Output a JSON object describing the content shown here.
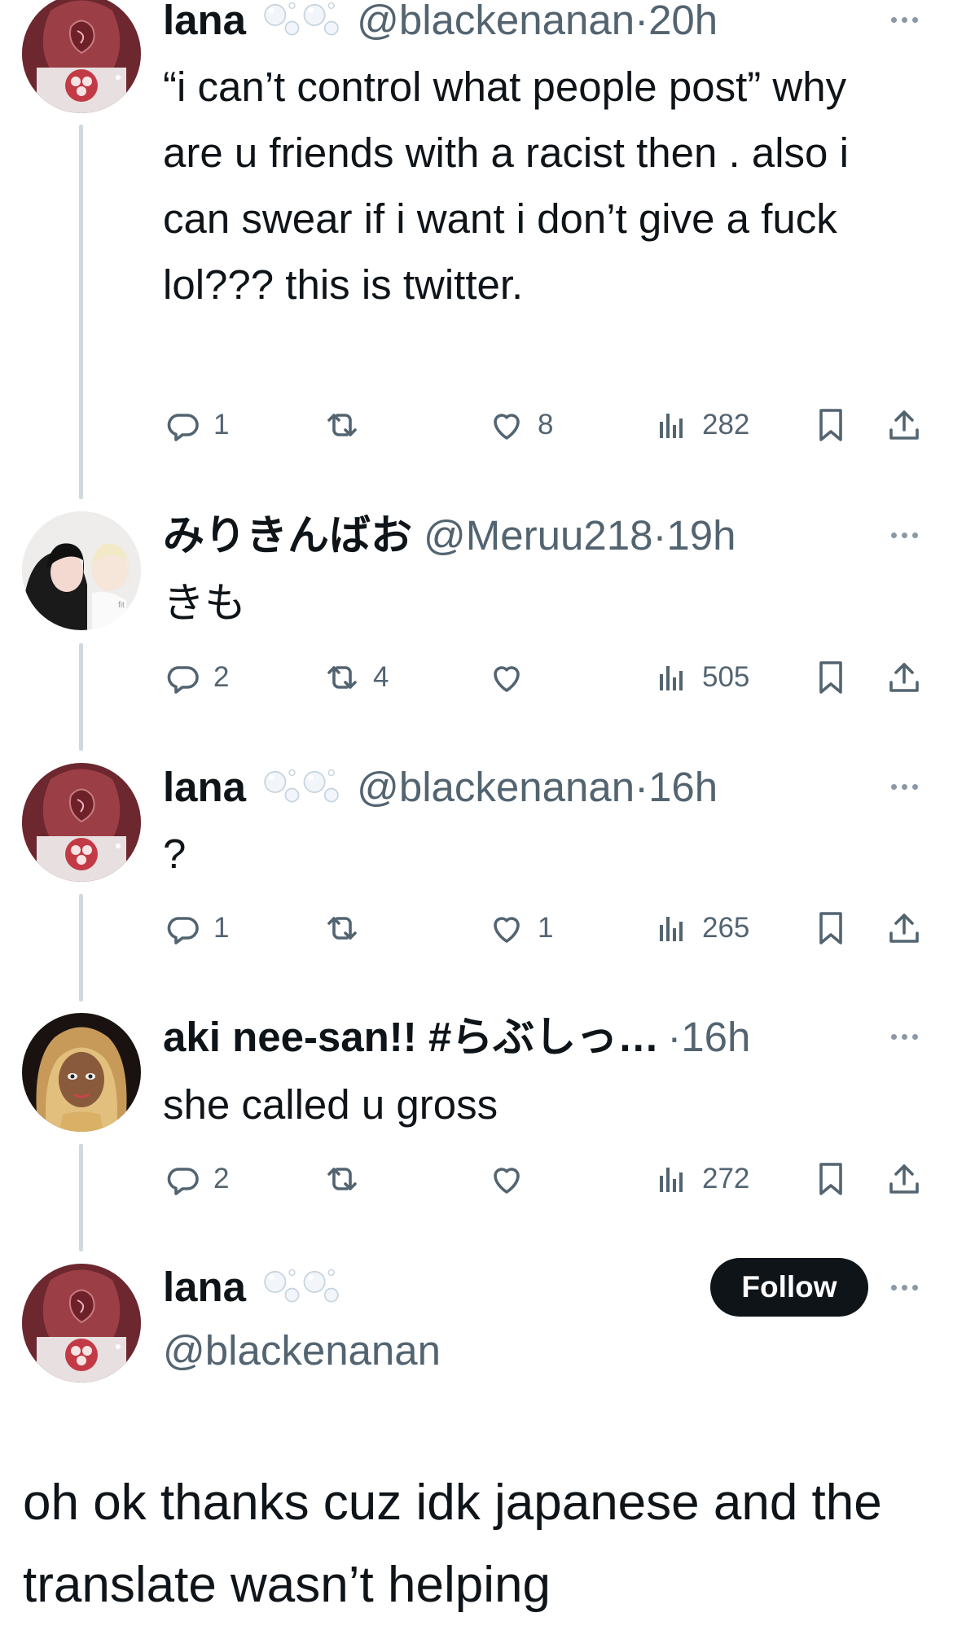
{
  "tweets": [
    {
      "name": "lana",
      "handle": "@blackenanan",
      "dot": "·",
      "time": "20h",
      "text": "“i can’t control what people post” why are u friends with a racist then . also i can swear if i want i don’t give a fuck lol??? this is twitter.",
      "replies": "1",
      "retweets": "",
      "likes": "8",
      "views": "282"
    },
    {
      "name": "みりきんばお",
      "handle": "@Meruu218",
      "dot": "·",
      "time": "19h",
      "text": "きも",
      "replies": "2",
      "retweets": "4",
      "likes": "",
      "views": "505"
    },
    {
      "name": "lana",
      "handle": "@blackenanan",
      "dot": "·",
      "time": "16h",
      "text": "?",
      "replies": "1",
      "retweets": "",
      "likes": "1",
      "views": "265"
    },
    {
      "name": "aki nee-san!! #らぶしっ…",
      "handle": "",
      "dot": "·",
      "time": "16h",
      "text": "she called u gross",
      "replies": "2",
      "retweets": "",
      "likes": "",
      "views": "272"
    }
  ],
  "composer": {
    "name": "lana",
    "handle": "@blackenanan",
    "follow_label": "Follow",
    "text": "oh ok thanks cuz idk japanese and the translate wasn’t helping"
  },
  "colors": {
    "text": "#0f1419",
    "secondary": "#536471",
    "thread_line": "#cfd9de",
    "follow_bg": "#0f1419"
  }
}
